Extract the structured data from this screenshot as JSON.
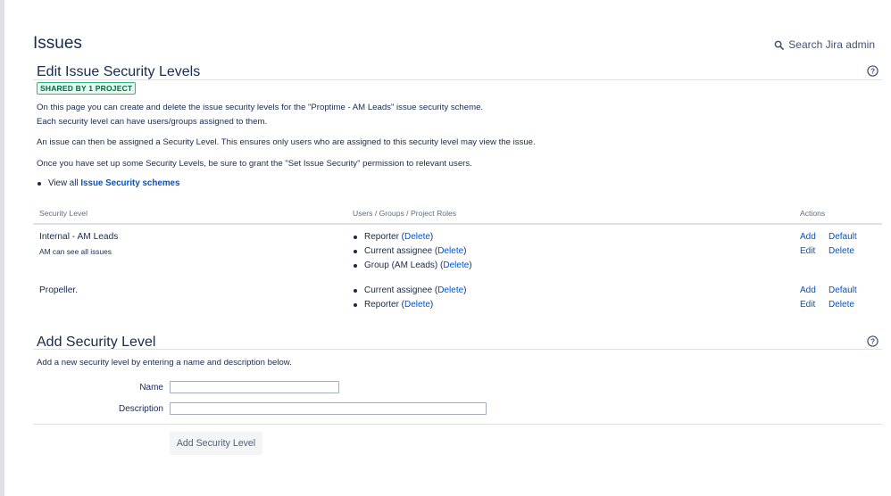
{
  "header": {
    "title": "Issues",
    "search_admin": "Search Jira admin"
  },
  "edit_section": {
    "title": "Edit Issue Security Levels",
    "shared_badge": "SHARED BY 1 PROJECT",
    "paragraphs": [
      "On this page you can create and delete the issue security levels for the \"Proptime - AM Leads\" issue security scheme.",
      "Each security level can have users/groups assigned to them.",
      "An issue can then be assigned a Security Level. This ensures only users who are assigned to this security level may view the issue.",
      "Once you have set up some Security Levels, be sure to grant the \"Set Issue Security\" permission to relevant users."
    ],
    "view_all_prefix": "View all",
    "view_all_link": "Issue Security schemes"
  },
  "table": {
    "columns": [
      "Security Level",
      "Users / Groups / Project Roles",
      "Actions"
    ],
    "rows": [
      {
        "name": "Internal - AM Leads",
        "description": "AM can see all issues",
        "members": [
          {
            "label": "Reporter (",
            "action": "Delete",
            "close": ")"
          },
          {
            "label": "Current assignee (",
            "action": "Delete",
            "close": ")"
          },
          {
            "label": "Group (AM Leads) (",
            "action": "Delete",
            "close": ")"
          }
        ],
        "actions": {
          "add": "Add",
          "default": "Default",
          "edit": "Edit",
          "delete": "Delete"
        }
      },
      {
        "name": "Propeller.",
        "description": "",
        "members": [
          {
            "label": "Current assignee (",
            "action": "Delete",
            "close": ")"
          },
          {
            "label": "Reporter (",
            "action": "Delete",
            "close": ")"
          }
        ],
        "actions": {
          "add": "Add",
          "default": "Default",
          "edit": "Edit",
          "delete": "Delete"
        }
      }
    ]
  },
  "add_section": {
    "title": "Add Security Level",
    "description": "Add a new security level by entering a name and description below.",
    "name_label": "Name",
    "name_value": "",
    "description_label": "Description",
    "description_value": "",
    "submit_label": "Add Security Level"
  },
  "colors": {
    "link": "#0052cc",
    "text": "#172b4d",
    "badge_border": "#36b37e",
    "badge_text": "#006644"
  }
}
